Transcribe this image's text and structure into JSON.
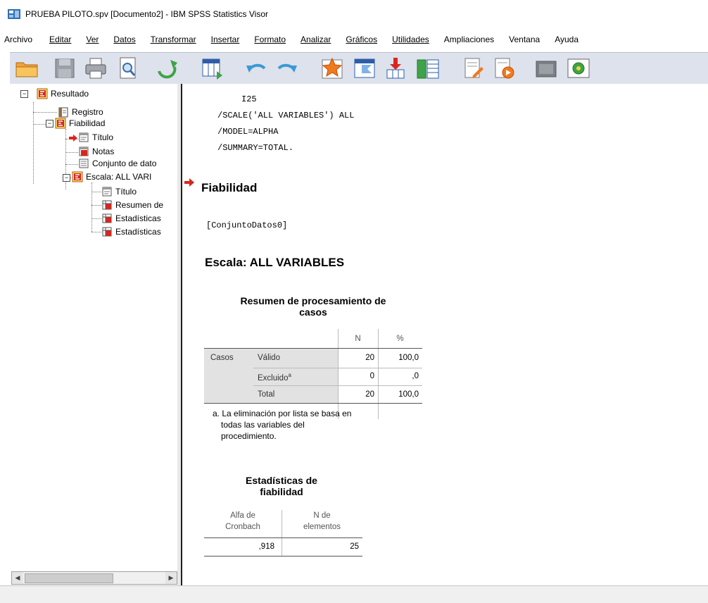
{
  "window": {
    "title": "PRUEBA PILOTO.spv [Documento2] - IBM SPSS Statistics Visor"
  },
  "menu": {
    "items": [
      {
        "label": "Archivo"
      },
      {
        "label": "Editar"
      },
      {
        "label": "Ver"
      },
      {
        "label": "Datos"
      },
      {
        "label": "Transformar"
      },
      {
        "label": "Insertar"
      },
      {
        "label": "Formato"
      },
      {
        "label": "Analizar"
      },
      {
        "label": "Gráficos"
      },
      {
        "label": "Utilidades"
      },
      {
        "label": "Ampliaciones"
      },
      {
        "label": "Ventana"
      },
      {
        "label": "Ayuda"
      }
    ]
  },
  "toolbar": {
    "icons": [
      "open-icon",
      "save-icon",
      "print-icon",
      "print-preview-icon",
      "export-icon",
      "data-editor-icon",
      "undo-icon",
      "redo-icon",
      "goto-case-icon",
      "goto-variable-icon",
      "insert-output-icon",
      "variables-icon",
      "create-edit-icon",
      "script-icon",
      "hide-icon",
      "designate-window-icon"
    ]
  },
  "tree": {
    "root": "Resultado",
    "registro": "Registro",
    "fiabilidad": "Fiabilidad",
    "titulo1": "Título",
    "notas": "Notas",
    "conjunto": "Conjunto de dato",
    "escala": "Escala: ALL VARI",
    "titulo2": "Título",
    "resumen": "Resumen de",
    "estadisticas1": "Estadísticas",
    "estadisticas2": "Estadísticas"
  },
  "output": {
    "syntax": [
      "I25",
      "/SCALE('ALL VARIABLES') ALL",
      "/MODEL=ALPHA",
      "/SUMMARY=TOTAL."
    ],
    "section_title": "Fiabilidad",
    "dataset": "[ConjuntoDatos0]",
    "scale_title": "Escala: ALL VARIABLES",
    "summary_table": {
      "title_line1": "Resumen de procesamiento de",
      "title_line2": "casos",
      "col_n": "N",
      "col_pct": "%",
      "group": "Casos",
      "rows": [
        {
          "label": "Válido",
          "sup": "",
          "n": "20",
          "pct": "100,0"
        },
        {
          "label": "Excluido",
          "sup": "a",
          "n": "0",
          "pct": ",0"
        },
        {
          "label": "Total",
          "sup": "",
          "n": "20",
          "pct": "100,0"
        }
      ],
      "footnote_line1": "a. La eliminación por lista se basa en",
      "footnote_line2": "todas las variables del",
      "footnote_line3": "procedimiento."
    },
    "reliability_table": {
      "title_line1": "Estadísticas de",
      "title_line2": "fiabilidad",
      "col1_line1": "Alfa de",
      "col1_line2": "Cronbach",
      "col2_line1": "N de",
      "col2_line2": "elementos",
      "alpha": ",918",
      "n_items": "25"
    }
  },
  "colors": {
    "toolbar_bg": "#dde2ec",
    "arrow_red": "#d9261c",
    "table_shade": "#e0e0e0"
  }
}
